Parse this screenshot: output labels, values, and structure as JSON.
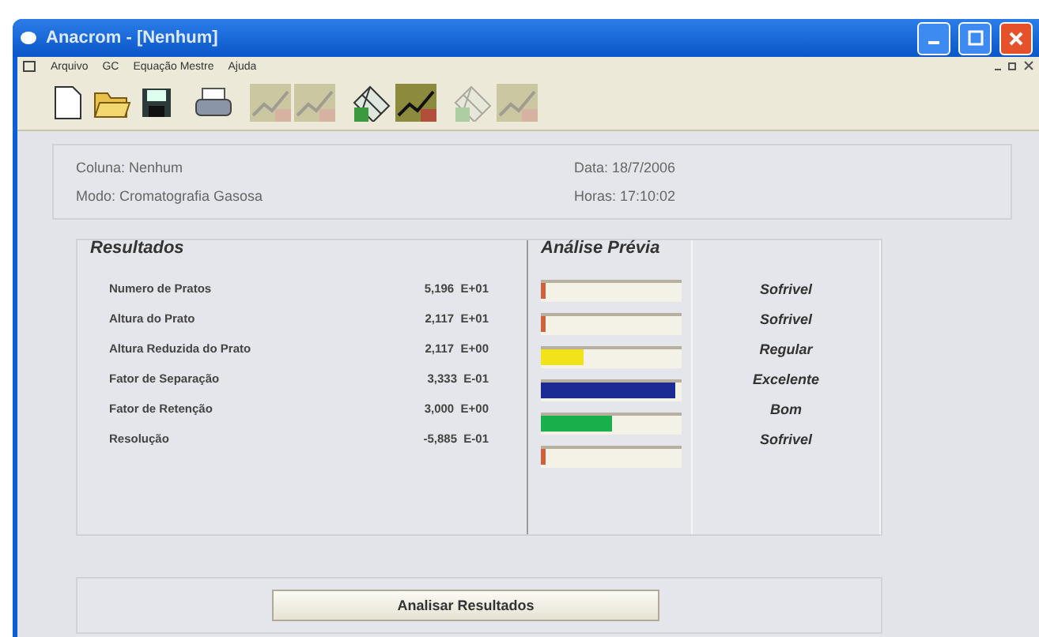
{
  "window": {
    "title": "Anacrom - [Nenhum]"
  },
  "menu": [
    {
      "label": "Arquivo"
    },
    {
      "label": "GC"
    },
    {
      "label": "Equação Mestre"
    },
    {
      "label": "Ajuda"
    }
  ],
  "toolbar": [
    {
      "kind": "new",
      "disabled": false
    },
    {
      "kind": "open",
      "disabled": false
    },
    {
      "kind": "save",
      "disabled": false
    },
    {
      "kind": "print",
      "disabled": false
    },
    {
      "kind": "chart",
      "disabled": true
    },
    {
      "kind": "chart",
      "disabled": true
    },
    {
      "kind": "tools",
      "disabled": false
    },
    {
      "kind": "chart",
      "disabled": false
    },
    {
      "kind": "tools",
      "disabled": true
    },
    {
      "kind": "chart",
      "disabled": true
    }
  ],
  "info": {
    "column": "Coluna: Nenhum",
    "mode": "Modo: Cromatografia Gasosa",
    "date": "Data: 18/7/2006",
    "time": "Horas: 17:10:02"
  },
  "results": {
    "title": "Resultados",
    "analysis_title": "Análise Prévia",
    "rows": [
      {
        "name": "Numero de Pratos",
        "value": "5,196  E+01",
        "level": 0.03,
        "color": "#d0603a",
        "rating": "Sofrivel"
      },
      {
        "name": "Altura do Prato",
        "value": "2,117  E+01",
        "level": 0.03,
        "color": "#d0603a",
        "rating": "Sofrivel"
      },
      {
        "name": "Altura Reduzida do Prato",
        "value": "2,117  E+00",
        "level": 0.3,
        "color": "#f2e21a",
        "rating": "Regular"
      },
      {
        "name": "Fator de Separação",
        "value": "3,333  E-01",
        "level": 0.95,
        "color": "#1c2a94",
        "rating": "Excelente"
      },
      {
        "name": "Fator de Retenção",
        "value": "3,000  E+00",
        "level": 0.5,
        "color": "#18b04a",
        "rating": "Bom"
      },
      {
        "name": "Resolução",
        "value": "-5,885  E-01",
        "level": 0.03,
        "color": "#d0603a",
        "rating": "Sofrivel"
      }
    ]
  },
  "buttons": [
    {
      "label": "Analisar Resultados"
    }
  ]
}
